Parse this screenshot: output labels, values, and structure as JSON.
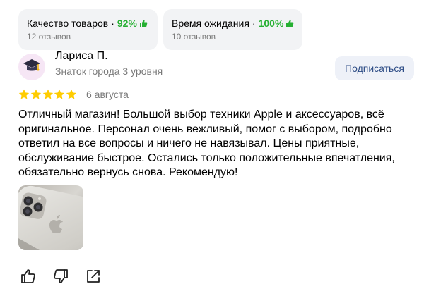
{
  "ratings": [
    {
      "label": "Качество товаров",
      "separator": "·",
      "percent": "92%",
      "count": "12 отзывов"
    },
    {
      "label": "Время ожидания",
      "separator": "·",
      "percent": "100%",
      "count": "10 отзывов"
    }
  ],
  "user": {
    "name": "Лариса П.",
    "level": "Знаток города 3 уровня",
    "subscribe_label": "Подписаться"
  },
  "review": {
    "stars": 5,
    "date": "6 августа",
    "text": "Отличный магазин! Большой выбор техники Apple и аксессуаров, всё оригинальное. Персонал очень вежливый, помог с выбором, подробно ответил на все вопросы и ничего не навязывал. Цены приятные, обслуживание быстрое. Остались только положительные впечатления, обязательно вернусь снова. Рекомендую!"
  },
  "colors": {
    "accent_green": "#26b032",
    "star": "#fc0",
    "subscribe_text": "#2e4d86"
  },
  "icons": {
    "avatar": "graduation-cap-icon",
    "thumb": "thumbs-up-icon",
    "like": "like-icon",
    "dislike": "dislike-icon",
    "share": "share-icon"
  }
}
